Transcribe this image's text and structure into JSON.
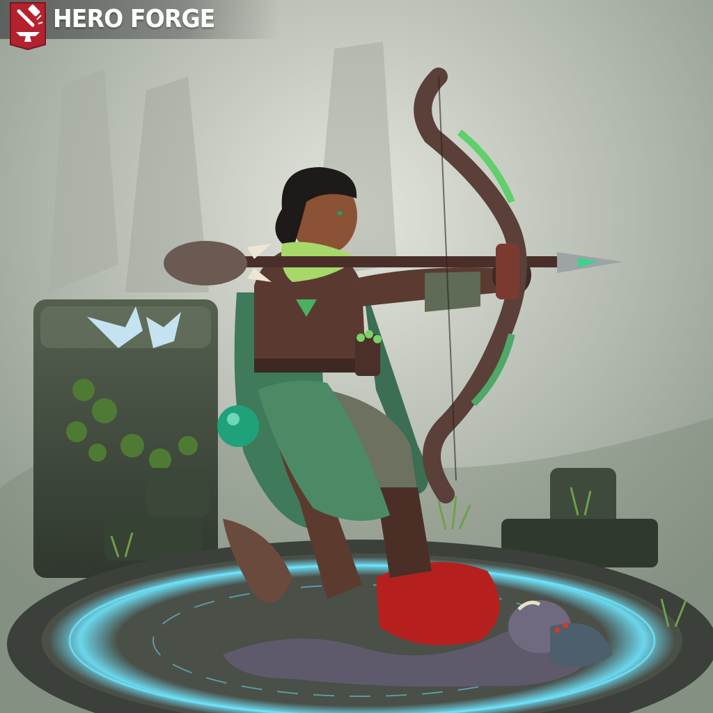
{
  "app": {
    "brand_name": "HERO FORGE",
    "logo_icon": "anvil-hammer-icon",
    "brand_color": "#b3222e"
  },
  "scene": {
    "figure": "archer-miniature",
    "base_glow_color": "#6fe6ff",
    "accent_green": "#7ccf6a"
  }
}
